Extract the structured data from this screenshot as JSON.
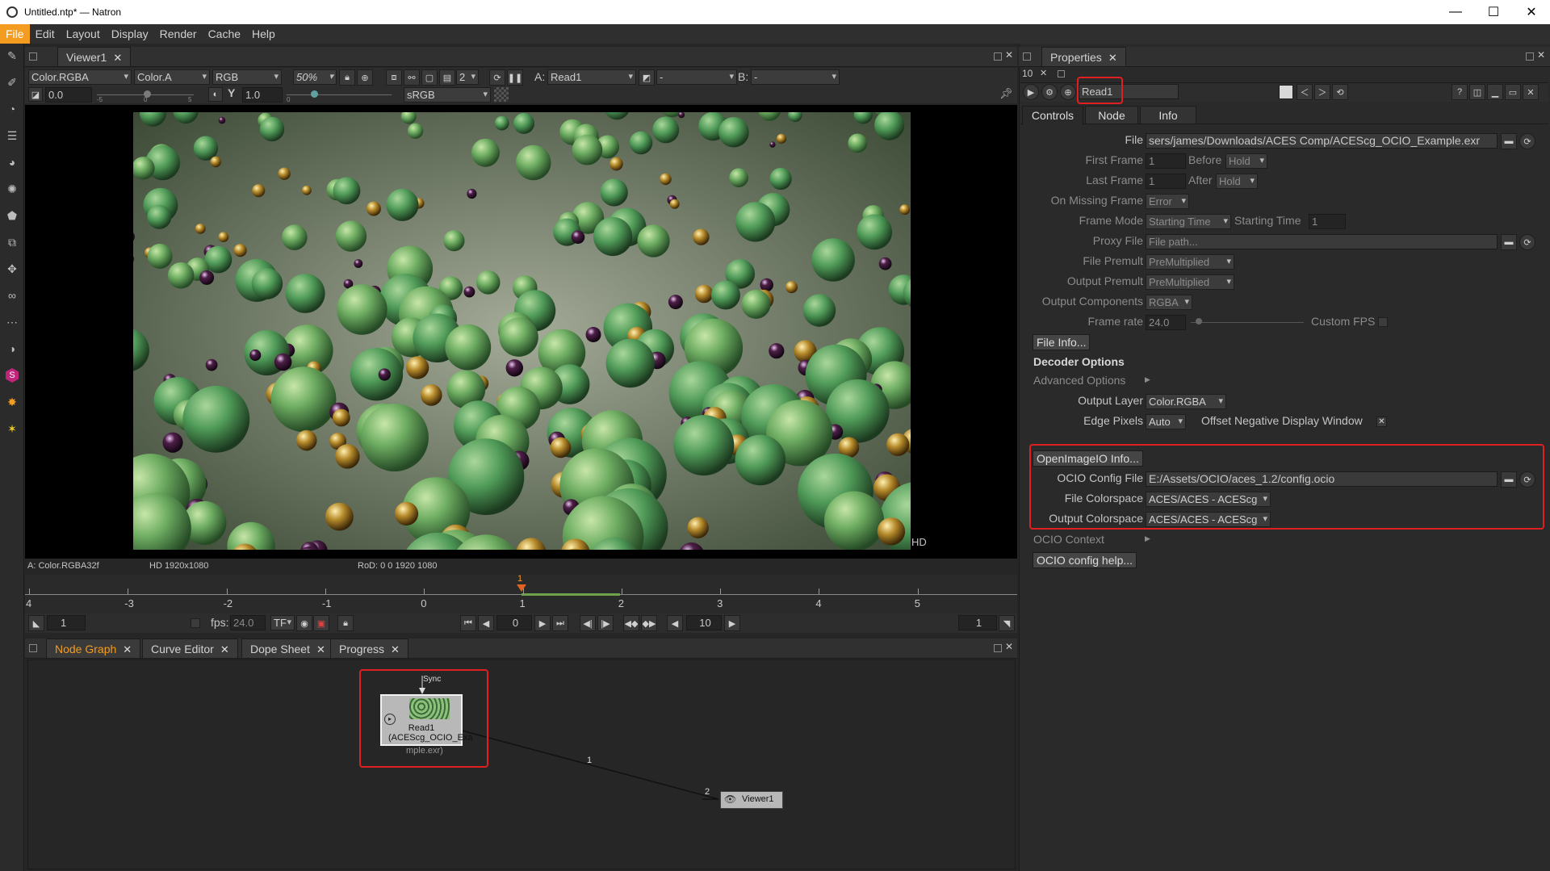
{
  "window": {
    "title": "Untitled.ntp* — Natron",
    "minimize": "—",
    "maximize": "☐",
    "close": "✕"
  },
  "menu": [
    "File",
    "Edit",
    "Layout",
    "Display",
    "Render",
    "Cache",
    "Help"
  ],
  "viewer": {
    "tab": "Viewer1",
    "layer": "Color.RGBA",
    "alpha": "Color.A",
    "display_channels": "RGB",
    "zoom": "50%",
    "proxy_level": "2",
    "input_a_label": "A:",
    "input_a": "Read1",
    "composite": "-",
    "input_b_label": "B:",
    "input_b": "-",
    "gain": "0.0",
    "gain_ticks": [
      "-5",
      "0",
      "5"
    ],
    "gamma_label": "Y",
    "gamma": "1.0",
    "gamma_tick": "0",
    "colorspace": "sRGB",
    "format_badge": "HD",
    "status_left": "A: Color.RGBA32f",
    "status_format": "HD 1920x1080",
    "status_rod": "RoD: 0 0 1920 1080"
  },
  "timeline": {
    "ticks": [
      "4",
      "-3",
      "-2",
      "-1",
      "0",
      "1",
      "2",
      "3",
      "4",
      "5"
    ],
    "current_marker": "1",
    "in_point": "1",
    "fps_label": "fps:",
    "fps": "24.0",
    "tf_label": "TF",
    "frame": "0",
    "increment": "10",
    "out_point": "1"
  },
  "bottom_tabs": [
    {
      "label": "Node Graph"
    },
    {
      "label": "Curve Editor"
    },
    {
      "label": "Dope Sheet"
    },
    {
      "label": "Progress"
    }
  ],
  "node_graph": {
    "read_node_label": "Read1",
    "read_node_sub1": "(ACEScg_OCIO_Exa",
    "read_node_sub2": "mple.exr)",
    "sync_label": "Sync",
    "edge_label": "1",
    "viewer_input": "2",
    "viewer_node": "Viewer1"
  },
  "properties": {
    "tab": "Properties",
    "max_panels": "10",
    "node_name": "Read1",
    "tabs": [
      "Controls",
      "Node",
      "Info"
    ],
    "file_label": "File",
    "file": "sers/james/Downloads/ACES Comp/ACEScg_OCIO_Example.exr",
    "first_frame_label": "First Frame",
    "first_frame": "1",
    "before_label": "Before",
    "before": "Hold",
    "last_frame_label": "Last Frame",
    "last_frame": "1",
    "after_label": "After",
    "after": "Hold",
    "missing_label": "On Missing Frame",
    "missing": "Error",
    "frame_mode_label": "Frame Mode",
    "frame_mode": "Starting Time",
    "starting_time_label": "Starting Time",
    "starting_time": "1",
    "proxy_label": "Proxy File",
    "proxy_placeholder": "File path...",
    "file_premult_label": "File Premult",
    "file_premult": "PreMultiplied",
    "output_premult_label": "Output Premult",
    "output_premult": "PreMultiplied",
    "output_components_label": "Output Components",
    "output_components": "RGBA",
    "frame_rate_label": "Frame rate",
    "frame_rate": "24.0",
    "custom_fps_label": "Custom FPS",
    "file_info_btn": "File Info...",
    "decoder_options": "Decoder Options",
    "advanced_options": "Advanced Options",
    "output_layer_label": "Output Layer",
    "output_layer": "Color.RGBA",
    "edge_pixels_label": "Edge Pixels",
    "edge_pixels": "Auto",
    "offset_neg_label": "Offset Negative Display Window",
    "oiio_btn": "OpenImageIO Info...",
    "ocio_config_label": "OCIO Config File",
    "ocio_config": "E:/Assets/OCIO/aces_1.2/config.ocio",
    "file_cs_label": "File Colorspace",
    "file_cs": "ACES/ACES - ACEScg",
    "out_cs_label": "Output Colorspace",
    "out_cs": "ACES/ACES - ACEScg",
    "ocio_context": "OCIO Context",
    "ocio_help_btn": "OCIO config help..."
  },
  "colors": {
    "accent": "#f39c1f",
    "highlight": "#e02020"
  }
}
